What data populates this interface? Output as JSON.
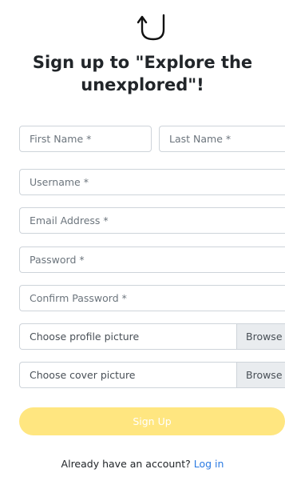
{
  "logo": {
    "icon": "arrow-u-turn-logo-icon"
  },
  "title": "Sign up to \"Explore the unexplored\"!",
  "form": {
    "first_name_placeholder": "First Name *",
    "last_name_placeholder": "Last Name *",
    "username_placeholder": "Username *",
    "email_placeholder": "Email Address *",
    "password_placeholder": "Password *",
    "confirm_password_placeholder": "Confirm Password *",
    "profile_picture_label": "Choose profile picture",
    "cover_picture_label": "Choose cover picture",
    "browse_label": "Browse",
    "submit_label": "Sign Up"
  },
  "footer": {
    "prompt": "Already have an account?",
    "login_label": "Log in"
  },
  "colors": {
    "button": "#ffe680",
    "link": "#2a7ae2"
  }
}
